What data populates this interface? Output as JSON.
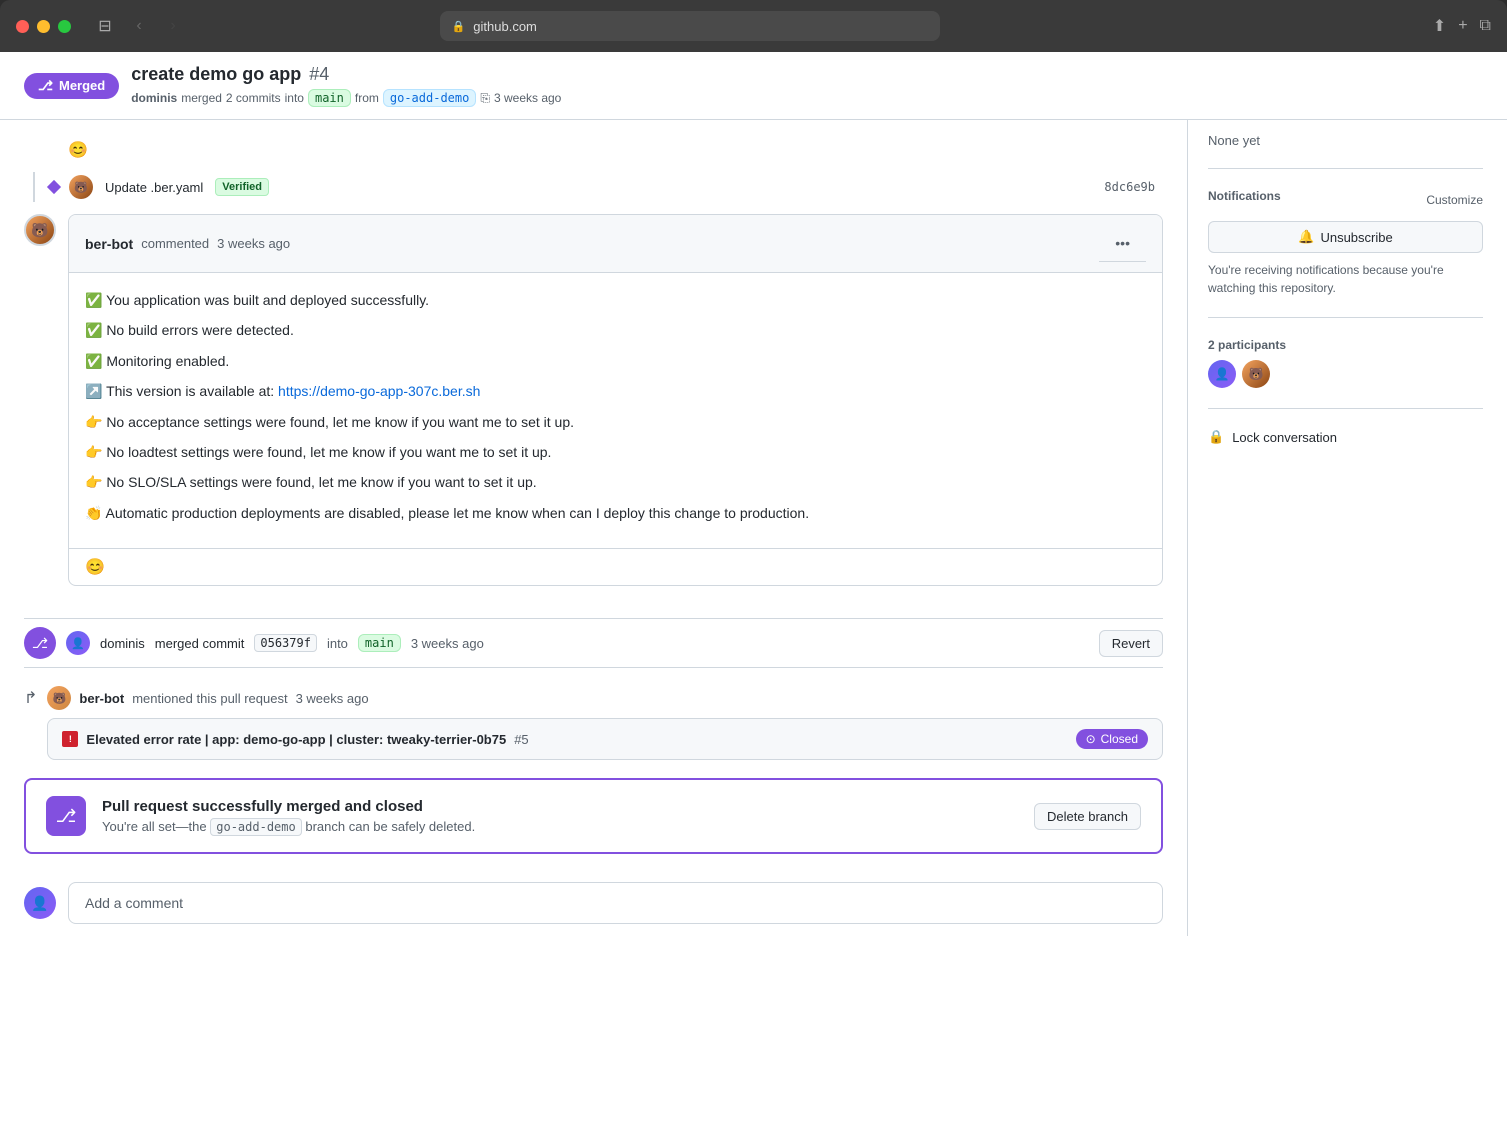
{
  "browser": {
    "url": "github.com",
    "url_display": "github.com"
  },
  "pr": {
    "title": "create demo go app",
    "number": "#4",
    "merged_badge": "Merged",
    "author": "dominis",
    "commits_count": "2 commits",
    "target_branch": "main",
    "source_branch": "go-add-demo",
    "time_ago": "3 weeks ago",
    "merged_into_text": "merged",
    "from_text": "from"
  },
  "commit": {
    "message": "Update .ber.yaml",
    "verified": "Verified",
    "hash": "8dc6e9b",
    "emoji_icon": "😊"
  },
  "comment": {
    "author": "ber-bot",
    "action": "commented",
    "time": "3 weeks ago",
    "line1": "✅ You application was built and deployed successfully.",
    "line2": "✅ No build errors were detected.",
    "line3": "✅ Monitoring enabled.",
    "line4": "↗️ This version is available at:",
    "link_url": "https://demo-go-app-307c.ber.sh",
    "link_text": "https://demo-go-app-307c.ber.sh",
    "line5": "👉 No acceptance settings were found, let me know if you want me to set it up.",
    "line6": "👉 No loadtest settings were found, let me know if you want me to set it up.",
    "line7": "👉 No SLO/SLA settings were found, let me know if you want to set it up.",
    "line8": "👏 Automatic production deployments are disabled, please let me know when can I deploy this change to production.",
    "emoji_icon": "😊"
  },
  "merge_event": {
    "author": "dominis",
    "action": "merged commit",
    "commit_hash": "056379f",
    "into_text": "into",
    "branch": "main",
    "time": "3 weeks ago",
    "revert_btn": "Revert"
  },
  "mention": {
    "author": "ber-bot",
    "action": "mentioned this pull request",
    "time": "3 weeks ago",
    "issue_emoji": "🟥",
    "issue_title": "Elevated error rate | app: demo-go-app | cluster: tweaky-terrier-0b75",
    "issue_number": "#5",
    "status": "Closed",
    "status_icon": "⊙"
  },
  "merged_box": {
    "title": "Pull request successfully merged and closed",
    "description_start": "You're all set—the",
    "branch_name": "go-add-demo",
    "description_end": "branch can be safely deleted.",
    "delete_btn": "Delete branch"
  },
  "add_comment": {
    "placeholder": "Add a comment"
  },
  "sidebar": {
    "none_yet": "None yet",
    "notifications_title": "Notifications",
    "customize_link": "Customize",
    "unsubscribe_btn": "Unsubscribe",
    "notification_reason": "You're receiving notifications because you're watching this repository.",
    "participants_count": "2 participants",
    "lock_conversation": "Lock conversation"
  },
  "colors": {
    "purple": "#8250df",
    "green": "#1a7f37",
    "blue": "#0969da",
    "border": "#d0d7de",
    "bg_light": "#f6f8fa"
  }
}
